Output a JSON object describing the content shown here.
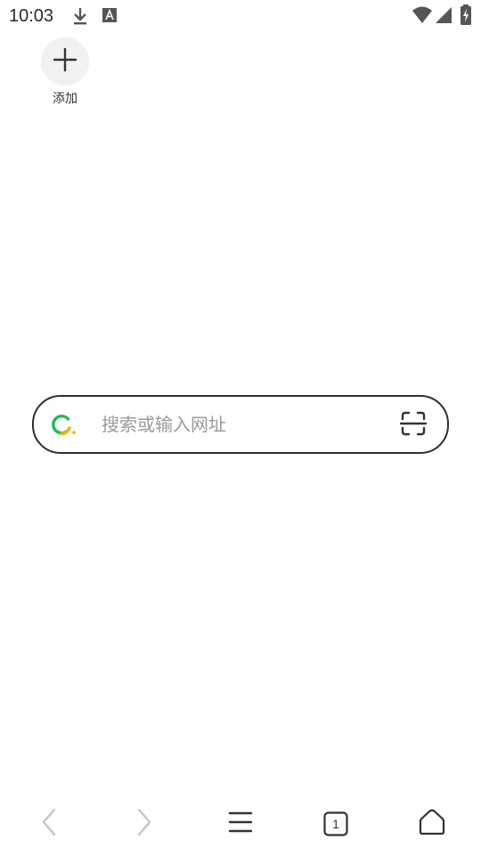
{
  "status_bar": {
    "time": "10:03",
    "icons": [
      "download-icon",
      "text-notification-icon",
      "wifi-icon",
      "cellular-signal-icon",
      "battery-charging-icon"
    ]
  },
  "shortcuts": {
    "add_label": "添加"
  },
  "search": {
    "placeholder": "搜索或输入网址",
    "value": ""
  },
  "bottom_nav": {
    "tab_count": "1",
    "buttons": [
      "back",
      "forward",
      "menu",
      "tabs",
      "home"
    ]
  },
  "colors": {
    "logo_green": "#1db954",
    "logo_yellow": "#f5b400",
    "border": "#2e2e2e",
    "disabled": "#c4c4c4",
    "icon": "#333333"
  }
}
